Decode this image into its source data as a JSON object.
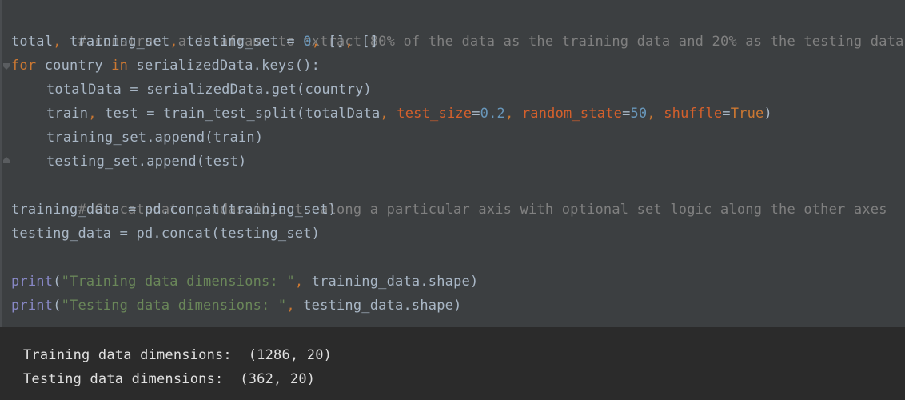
{
  "code": {
    "comment1": "# construct a dataframe to extract 80% of the data as the training data and 20% as the testing data.",
    "l2_a": "total",
    "l2_b": ",",
    "l2_c": " training_set",
    "l2_d": ",",
    "l2_e": " testing_set = ",
    "l2_f": "0",
    "l2_g": ",",
    "l2_h": " []",
    "l2_i": ",",
    "l2_j": " []",
    "l3_kw1": "for",
    "l3_a": " country ",
    "l3_kw2": "in",
    "l3_b": " serializedData.keys():",
    "l4": "totalData = serializedData.get(country)",
    "l5_a": "train",
    "l5_b": ",",
    "l5_c": " test = train_test_split(totalData",
    "l5_d": ",",
    "l5_e": " ",
    "l5_p1": "test_size",
    "l5_eq1": "=",
    "l5_n1": "0.2",
    "l5_f": ",",
    "l5_g": " ",
    "l5_p2": "random_state",
    "l5_eq2": "=",
    "l5_n2": "50",
    "l5_h": ",",
    "l5_i": " ",
    "l5_p3": "shuffle",
    "l5_eq3": "=",
    "l5_true": "True",
    "l5_j": ")",
    "l6": "training_set.append(train)",
    "l7": "testing_set.append(test)",
    "comment2": "# Concatenate pandas objects along a particular axis with optional set logic along the other axes",
    "l9": "training_data = pd.concat(training_set)",
    "l10": "testing_data = pd.concat(testing_set)",
    "l12_fn": "print",
    "l12_a": "(",
    "l12_str": "\"Training data dimensions: \"",
    "l12_b": ",",
    "l12_c": " training_data.shape)",
    "l13_fn": "print",
    "l13_a": "(",
    "l13_str": "\"Testing data dimensions: \"",
    "l13_b": ",",
    "l13_c": " testing_data.shape)"
  },
  "output": {
    "line1": "Training data dimensions:  (1286, 20)",
    "line2": "Testing data dimensions:  (362, 20)"
  }
}
